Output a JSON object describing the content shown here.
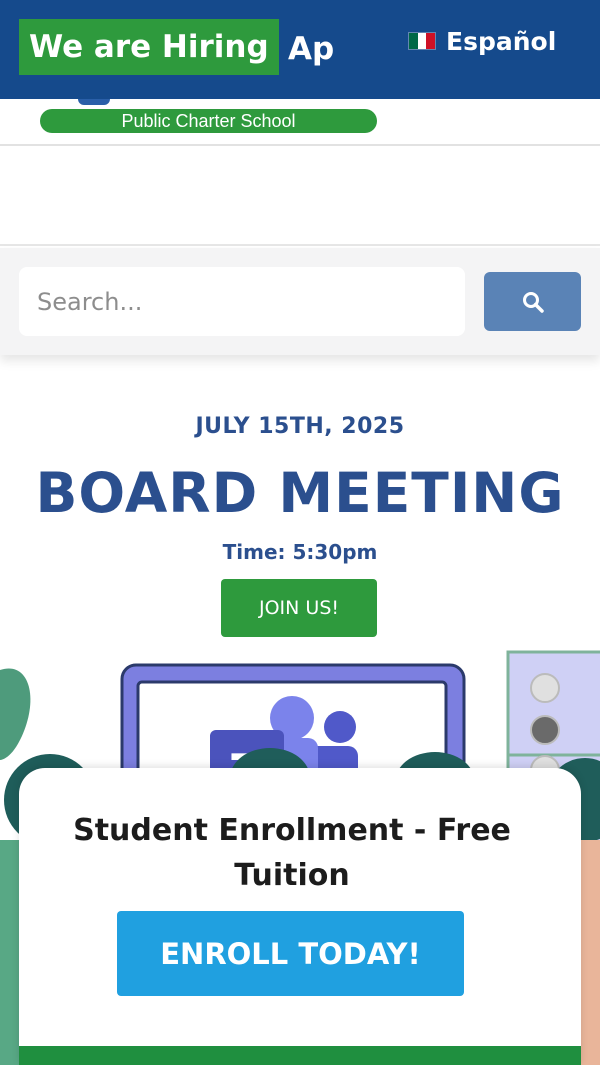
{
  "topbar": {
    "hiring_label": "We are Hiring",
    "marquee_tail": "Ap",
    "language_label": "Español",
    "flag_colors": [
      "#006847",
      "#ffffff",
      "#ce1126"
    ]
  },
  "logo": {
    "subtitle": "Public Charter School"
  },
  "search": {
    "placeholder": "Search...",
    "button_icon": "search-icon"
  },
  "event": {
    "date": "JULY 15TH, 2025",
    "title": "BOARD MEETING",
    "time": "Time: 5:30pm",
    "join_label": "JOIN US!"
  },
  "popup": {
    "title": "Student Enrollment - Free Tuition",
    "button_label": "ENROLL TODAY!"
  },
  "colors": {
    "brand_blue": "#154a8c",
    "brand_green": "#2e9a3d",
    "heading_blue": "#2b4f8e",
    "enroll_blue": "#20a0e0"
  }
}
